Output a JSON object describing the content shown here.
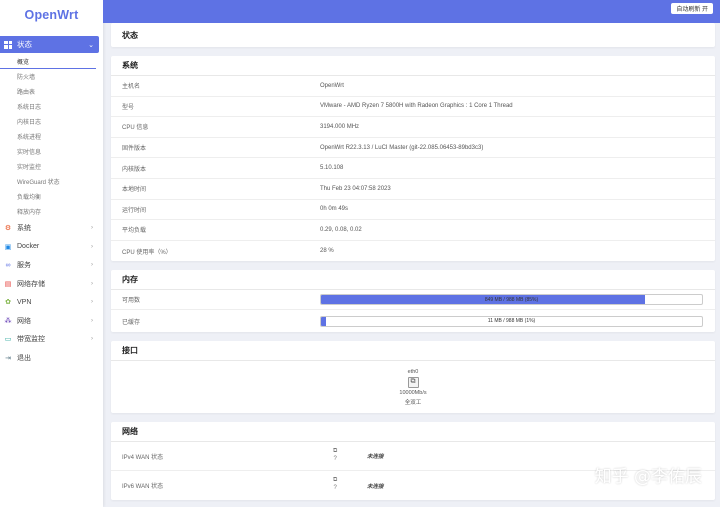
{
  "brand": "OpenWrt",
  "header": {
    "autorefresh_label": "自动刷新 开"
  },
  "sidebar": {
    "active_category": "状态",
    "sub_items": [
      {
        "label": "概览",
        "active": true
      },
      {
        "label": "防火墙",
        "active": false
      },
      {
        "label": "路由表",
        "active": false
      },
      {
        "label": "系统日志",
        "active": false
      },
      {
        "label": "内核日志",
        "active": false
      },
      {
        "label": "系统进程",
        "active": false
      },
      {
        "label": "实时信息",
        "active": false
      },
      {
        "label": "实时监控",
        "active": false
      },
      {
        "label": "WireGuard 状态",
        "active": false
      },
      {
        "label": "负载均衡",
        "active": false
      },
      {
        "label": "释放内存",
        "active": false
      }
    ],
    "categories": [
      {
        "label": "系统",
        "icon": "gear-icon",
        "color": "#e64a19",
        "arrow": true
      },
      {
        "label": "Docker",
        "icon": "docker-icon",
        "color": "#1e88e5",
        "arrow": true
      },
      {
        "label": "服务",
        "icon": "link-icon",
        "color": "#5e72e4",
        "arrow": true
      },
      {
        "label": "网络存储",
        "icon": "storage-icon",
        "color": "#e53935",
        "arrow": true
      },
      {
        "label": "VPN",
        "icon": "vpn-icon",
        "color": "#7cb342",
        "arrow": true
      },
      {
        "label": "网络",
        "icon": "network-icon",
        "color": "#5e35b1",
        "arrow": true
      },
      {
        "label": "带宽监控",
        "icon": "monitor-icon",
        "color": "#26a69a",
        "arrow": true
      },
      {
        "label": "退出",
        "icon": "logout-icon",
        "color": "#607d8b",
        "arrow": false
      }
    ]
  },
  "page": {
    "title": "状态"
  },
  "system": {
    "title": "系统",
    "rows": [
      {
        "key": "主机名",
        "value": "OpenWrt"
      },
      {
        "key": "型号",
        "value": "VMware - AMD Ryzen 7 5800H with Radeon Graphics : 1 Core 1 Thread"
      },
      {
        "key": "CPU 信息",
        "value": "3194.000 MHz"
      },
      {
        "key": "固件版本",
        "value": "OpenWrt R22.3.13 / LuCI Master (git-22.085.06453-89bd3c3)"
      },
      {
        "key": "内核版本",
        "value": "5.10.108"
      },
      {
        "key": "本地时间",
        "value": "Thu Feb 23 04:07:58 2023"
      },
      {
        "key": "运行时间",
        "value": "0h 0m 49s"
      },
      {
        "key": "平均负载",
        "value": "0.29, 0.08, 0.02"
      },
      {
        "key": "CPU 使用率（%）",
        "value": "28 %"
      }
    ]
  },
  "memory": {
    "title": "内存",
    "rows": [
      {
        "key": "可用数",
        "text": "849 MB / 988 MB (85%)",
        "fraction": 0.85
      },
      {
        "key": "已缓存",
        "text": "11 MB / 988 MB (1%)",
        "fraction": 0.011
      }
    ]
  },
  "interfaces": {
    "title": "接口",
    "port_name": "eth0",
    "speed": "10000Mb/s",
    "duplex": "全双工"
  },
  "network": {
    "title": "网络",
    "rows": [
      {
        "key": "IPv4 WAN 状态",
        "icon_label": "?",
        "status": "未连接"
      },
      {
        "key": "IPv6 WAN 状态",
        "icon_label": "?",
        "status": "未连接"
      }
    ]
  },
  "watermark": "知乎 @李佑辰",
  "colors": {
    "accent": "#5e72e4",
    "background": "#eef0f6"
  }
}
